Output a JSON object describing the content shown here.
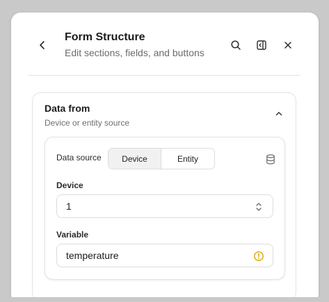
{
  "panel": {
    "title": "Form Structure",
    "subtitle": "Edit sections, fields, and buttons",
    "icons": {
      "back": "chevron-left-icon",
      "search": "search-icon",
      "sidebar": "sidebar-toggle-icon",
      "close": "close-icon"
    }
  },
  "section": {
    "title": "Data from",
    "subtitle": "Device or entity source",
    "collapse_icon": "chevron-up-icon"
  },
  "data_source": {
    "label": "Data source",
    "options": [
      {
        "label": "Device",
        "selected": true
      },
      {
        "label": "Entity",
        "selected": false
      }
    ],
    "icon": "database-icon"
  },
  "device_field": {
    "label": "Device",
    "value": "1",
    "icon": "chevron-up-down-icon"
  },
  "variable_field": {
    "label": "Variable",
    "value": "temperature",
    "icon": "warning-circle-icon",
    "warning_color": "#e0a100"
  }
}
